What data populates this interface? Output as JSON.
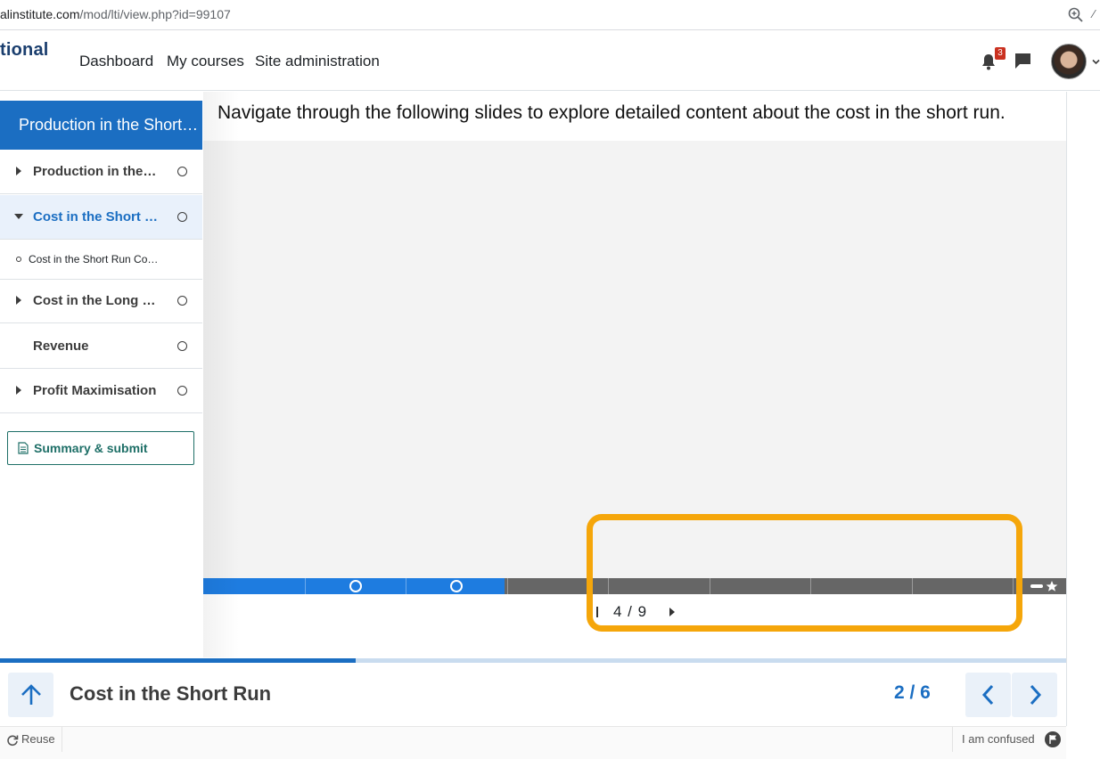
{
  "browser": {
    "url_host": "alinstitute.com",
    "url_path": "/mod/lti/view.php?id=99107"
  },
  "topnav": {
    "brand": "tional",
    "links": [
      "Dashboard",
      "My courses",
      "Site administration"
    ],
    "notification_count": "3"
  },
  "sidebar": {
    "header": "Production in the Short Run",
    "items": [
      {
        "label": "Production in the Short Run"
      },
      {
        "label": "Cost in the Short Run"
      },
      {
        "label": "Cost in the Long Run"
      },
      {
        "label": "Revenue"
      },
      {
        "label": "Profit Maximisation"
      }
    ],
    "subitem": "Cost in the Short Run Content",
    "summary_button": "Summary & submit"
  },
  "main": {
    "instruction": "Navigate through the following slides to explore detailed content about the cost in the short run.",
    "slide_counter": "4 / 9",
    "slide_progress": {
      "current": 4,
      "total": 9
    }
  },
  "footer": {
    "title": "Cost in the Short Run",
    "page_counter": "2 / 6",
    "page_progress": {
      "current": 2,
      "total": 6
    }
  },
  "status": {
    "reuse": "Reuse",
    "confused": "I am confused"
  },
  "colors": {
    "primary": "#1b6ec2",
    "progress_fill": "#1e7ce0",
    "highlight": "#f5a60a",
    "summary": "#1e6f67",
    "badge": "#ca3120"
  }
}
